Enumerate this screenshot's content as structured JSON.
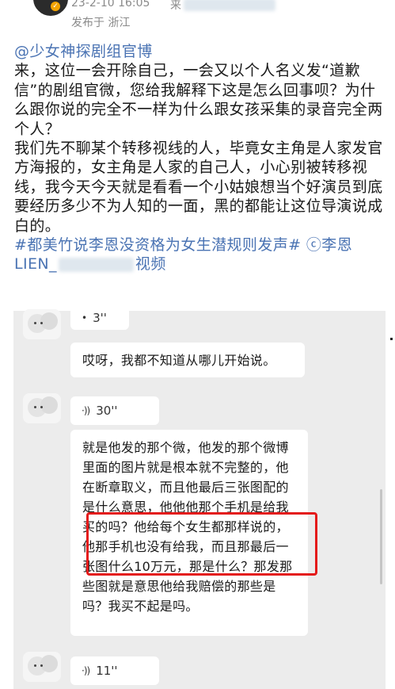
{
  "header": {
    "time": "23-2-10 16:05",
    "source_label": "来",
    "location": "发布于 浙江"
  },
  "post": {
    "mention": "@少女神探剧组官博",
    "paragraph_1": "来，这位一会开除自己，一会又以个人名义发“道歉信”的剧组官微，您给我解释下这是怎么回事呗？为什么跟你说的完全不一样为什么跟女孩采集的录音完全两个人？",
    "paragraph_2": "我们先不聊某个转移视线的人，毕竟女主角是人家发官方海报的，女主角是人家的自己人，小心别被转移视线，我今天今天就是看看一个小姑娘想当个好演员到底要经历多少不为人知的一面，黑的都能让这位导演说成白的。",
    "hashtag": "#都美竹说李恩没资格为女生潜规则发声#",
    "video_link_prefix": "ⓒ李恩",
    "video_link_line2_start": "LIEN_",
    "video_link_line2_end": "视频"
  },
  "chat": {
    "messages": [
      {
        "kind": "voice",
        "duration": "3''"
      },
      {
        "kind": "text",
        "text": "哎呀，我都不知道从哪儿开始说。"
      },
      {
        "kind": "voice",
        "duration": "30''"
      },
      {
        "kind": "text",
        "text": "就是他发的那个微，他发的那个微博里面的图片就是根本就不完整的，他在断章取义，而且他最后三张图配的是什么意思，他他他那个手机是给我买的吗？他给每个女生都那样说的，他那手机也没有给我，而且那最后一张图什么10万元，那是什么？那发那些图就是意思他给我赔偿的那些是吗？我买不起是吗。"
      },
      {
        "kind": "voice",
        "duration": "11''"
      }
    ]
  },
  "colors": {
    "link_blue": "#4a73b3",
    "highlight_red": "#e41b1b",
    "chat_background": "#ececec",
    "badge_orange": "#f4a300"
  },
  "icons": {
    "voice": "voice-wave-icon",
    "badge": "verified-badge-icon"
  }
}
